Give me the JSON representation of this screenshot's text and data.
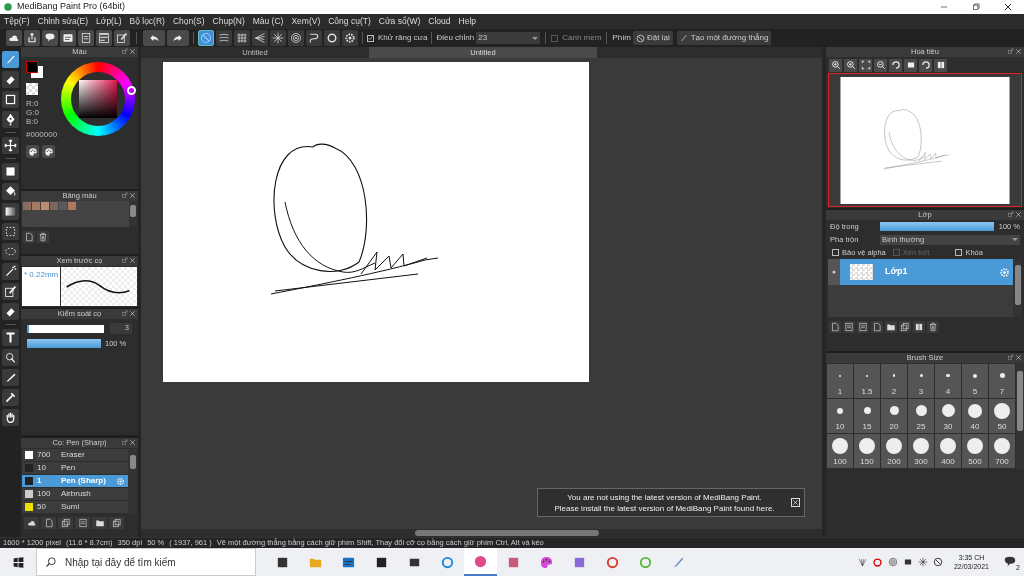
{
  "window": {
    "title": "MediBang Paint Pro (64bit)"
  },
  "menu": [
    "Tệp(F)",
    "Chỉnh sửa(E)",
    "Lớp(L)",
    "Bộ lọc(R)",
    "Chọn(S)",
    "Chụp(N)",
    "Màu (C)",
    "Xem(V)",
    "Công cụ(T)",
    "Cửa sổ(W)",
    "Cloud",
    "Help"
  ],
  "toolbar": {
    "snap_buttons": [
      {
        "selected": true
      },
      {
        "selected": false
      },
      {
        "selected": false
      },
      {
        "selected": false
      },
      {
        "selected": false
      },
      {
        "selected": false
      },
      {
        "selected": false
      },
      {
        "selected": false
      },
      {
        "selected": false
      }
    ],
    "antialias": {
      "label": "Khử răng cưa",
      "checked": true
    },
    "correction": {
      "label": "Điều chỉnh",
      "value": "23"
    },
    "soft_edge": {
      "label": "Canh mềm",
      "checked": false
    },
    "key_label": "Phím",
    "reset_button": "Đặt lại",
    "line_button": "Tạo một đường thẳng"
  },
  "tools": [
    {
      "selected": true
    },
    {
      "selected": false
    },
    {
      "selected": false
    },
    {
      "selected": false
    },
    {
      "selected": false
    },
    {
      "selected": false
    },
    {
      "selected": false
    },
    {
      "selected": false
    },
    {
      "selected": false
    },
    {
      "selected": false
    },
    {
      "selected": false
    },
    {
      "selected": false
    },
    {
      "selected": false
    },
    {
      "selected": false
    },
    {
      "selected": false
    },
    {
      "selected": false
    },
    {
      "selected": false
    },
    {
      "selected": false
    }
  ],
  "color_panel": {
    "title": "Màu",
    "rgb": [
      "R:0",
      "G:0",
      "B:0"
    ],
    "hex": "#000000"
  },
  "palette_panel": {
    "title": "Bảng màu",
    "swatches": [
      {
        "color": "#8c6a5e"
      },
      {
        "color": "#a87a62"
      },
      {
        "color": "#b98c74"
      },
      {
        "color": "#7a6560"
      },
      {
        "color": "#5a5a5a"
      },
      {
        "color": "#b07860"
      }
    ]
  },
  "brush_preview": {
    "title": "Xem trước cọ",
    "size": "* 0.22mm"
  },
  "brush_control": {
    "title": "Kiểm soát cọ",
    "sliders": [
      {
        "kind": "boxed",
        "level": 0.03,
        "reading": "3"
      },
      {
        "kind": "plain",
        "level": 1,
        "reading": "100 %"
      }
    ]
  },
  "brush_list": {
    "title": "Cọ: Pen (Sharp)",
    "items": [
      {
        "size": "700",
        "name": "Eraser",
        "color": "#ffffff",
        "selected": false
      },
      {
        "size": "10",
        "name": "Pen",
        "color": "#222222",
        "selected": false
      },
      {
        "size": "1",
        "name": "Pen (Sharp)",
        "color": "#222222",
        "selected": true
      },
      {
        "size": "100",
        "name": "Airbrush",
        "color": "#cccccc",
        "selected": false
      },
      {
        "size": "50",
        "name": "Sumi",
        "color": "#f0e000",
        "selected": false
      }
    ]
  },
  "canvas_tabs": [
    {
      "label": "Untitled",
      "selected": false
    },
    {
      "label": "Untitled",
      "selected": true
    }
  ],
  "notification": {
    "lines": [
      "You are not using the latest version of MediBang Paint.",
      "Please install the latest version of MediBang Paint found here."
    ]
  },
  "navigator": {
    "title": "Hoa tiêu"
  },
  "layer_panel": {
    "title": "Lớp",
    "opacity": {
      "label": "Độ trong",
      "level": 1,
      "reading": "100 %"
    },
    "blend": {
      "label": "Pha trộn",
      "value": "Bình thường"
    },
    "options": [
      {
        "label": "Bảo vệ alpha",
        "checked": false,
        "disabled": false
      },
      {
        "label": "Xén bớt",
        "checked": false,
        "disabled": true
      },
      {
        "label": "Khóa",
        "checked": false,
        "disabled": false
      }
    ],
    "layers": [
      {
        "name": "Lớp1",
        "selected": true
      }
    ]
  },
  "brush_size": {
    "title": "Brush Size",
    "sizes": [
      "1",
      "1.5",
      "2",
      "3",
      "4",
      "5",
      "7",
      "10",
      "15",
      "20",
      "25",
      "30",
      "40",
      "50",
      "100",
      "150",
      "200",
      "300",
      "400",
      "500",
      "700"
    ]
  },
  "status_bar": [
    "1600 * 1200 pixel",
    "(11.6 * 8.7cm)",
    "350 dpi",
    "50 %",
    "( 1937, 961 )",
    "Vẽ một đường thẳng bằng cách giữ phím Shift, Thay đổi cỡ cọ bằng cách giữ phím Ctrl, Alt và kéo"
  ],
  "taskbar": {
    "search_placeholder": "Nhập tại đây để tìm kiếm",
    "time": "3:35 CH",
    "date": "22/03/2021",
    "notifications": "2"
  }
}
